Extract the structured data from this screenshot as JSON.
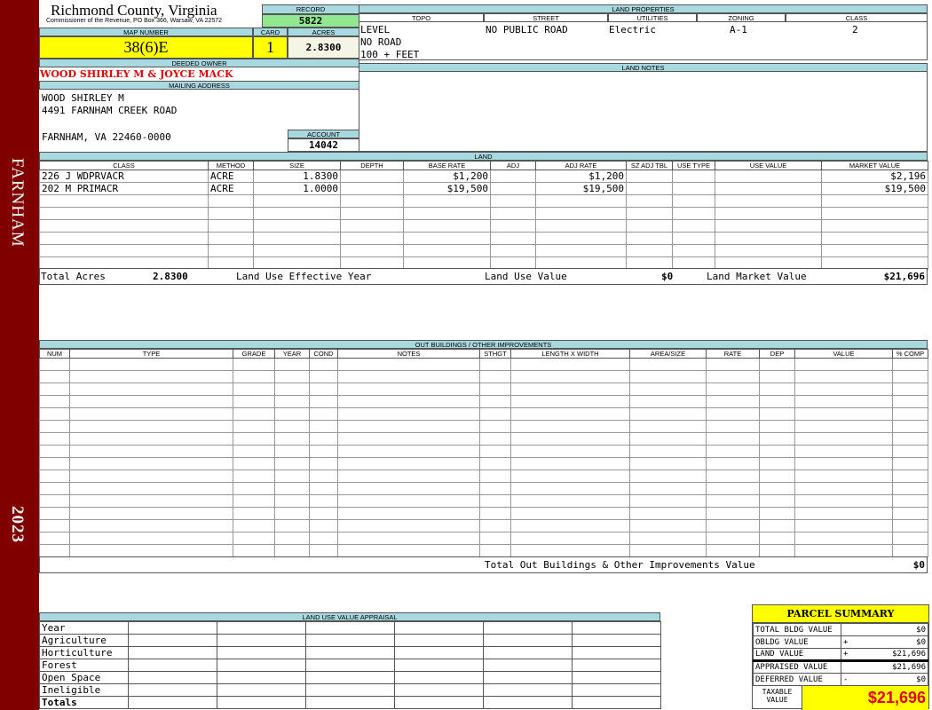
{
  "side": {
    "district": "FARNHAM",
    "year": "2023",
    "color": "#800000"
  },
  "header": {
    "title": "Richmond County, Virginia",
    "subtitle": "Commissioner of the Revenue, PO Box 366, Warsaw, VA 22572",
    "record_label": "RECORD",
    "record": "5822"
  },
  "parcel": {
    "map_label": "MAP NUMBER",
    "map": "38(6)E",
    "card_label": "CARD",
    "card": "1",
    "acres_label": "ACRES",
    "acres": "2.8300"
  },
  "owner": {
    "label": "DEEDED OWNER",
    "name": "WOOD SHIRLEY M & JOYCE MACK"
  },
  "mailing": {
    "label": "MAILING ADDRESS",
    "line1": "WOOD SHIRLEY M",
    "line2": "4491 FARNHAM CREEK ROAD",
    "line3": "FARNHAM, VA 22460-0000",
    "account_label": "ACCOUNT",
    "account": "14042"
  },
  "land_properties": {
    "label": "LAND PROPERTIES",
    "columns": [
      "TOPO",
      "STREET",
      "UTILITIES",
      "ZONING",
      "CLASS"
    ],
    "topo": [
      "LEVEL",
      "NO ROAD",
      "100 + FEET"
    ],
    "street": "NO PUBLIC ROAD",
    "utilities": "Electric",
    "zoning": "A-1",
    "class": "2"
  },
  "land_notes": {
    "label": "LAND NOTES"
  },
  "land": {
    "label": "LAND",
    "columns": [
      "CLASS",
      "METHOD",
      "SIZE",
      "DEPTH",
      "BASE RATE",
      "ADJ",
      "ADJ RATE",
      "SZ ADJ TBL",
      "USE TYPE",
      "USE VALUE",
      "MARKET VALUE"
    ],
    "rows": [
      [
        "226 J WDPRVACR",
        "ACRE",
        "1.8300",
        "",
        "$1,200",
        "",
        "$1,200",
        "",
        "",
        "",
        "$2,196"
      ],
      [
        "202 M PRIMACR",
        "ACRE",
        "1.0000",
        "",
        "$19,500",
        "",
        "$19,500",
        "",
        "",
        "",
        "$19,500"
      ]
    ],
    "total_acres_label": "Total Acres",
    "total_acres": "2.8300",
    "effective_year_label": "Land Use Effective Year",
    "use_value_label": "Land Use Value",
    "use_value": "$0",
    "market_value_label": "Land Market Value",
    "market_value": "$21,696"
  },
  "outbuildings": {
    "label": "OUT BUILDINGS / OTHER IMPROVEMENTS",
    "columns": [
      "NUM",
      "TYPE",
      "GRADE",
      "YEAR",
      "COND",
      "NOTES",
      "STHGT",
      "LENGTH X WIDTH",
      "AREA/SIZE",
      "RATE",
      "DEP",
      "VALUE",
      "% COMP"
    ],
    "total_label": "Total Out Buildings & Other Improvements Value",
    "total": "$0"
  },
  "land_use": {
    "label": "LAND USE VALUE APPRAISAL",
    "rows": [
      "Year",
      "Agriculture",
      "Horticulture",
      "Forest",
      "Open Space",
      "Ineligible",
      "Totals"
    ]
  },
  "summary": {
    "title": "PARCEL SUMMARY",
    "rows": [
      {
        "label": "TOTAL BLDG VALUE",
        "op": "",
        "value": "$0"
      },
      {
        "label": "OBLDG VALUE",
        "op": "+",
        "value": "$0"
      },
      {
        "label": "LAND VALUE",
        "op": "+",
        "value": "$21,696"
      },
      {
        "label": "APPRAISED VALUE",
        "op": "",
        "value": "$21,696"
      },
      {
        "label": "DEFERRED VALUE",
        "op": "-",
        "value": "$0"
      }
    ],
    "taxable_label": "TAXABLE VALUE",
    "taxable": "$21,696"
  }
}
